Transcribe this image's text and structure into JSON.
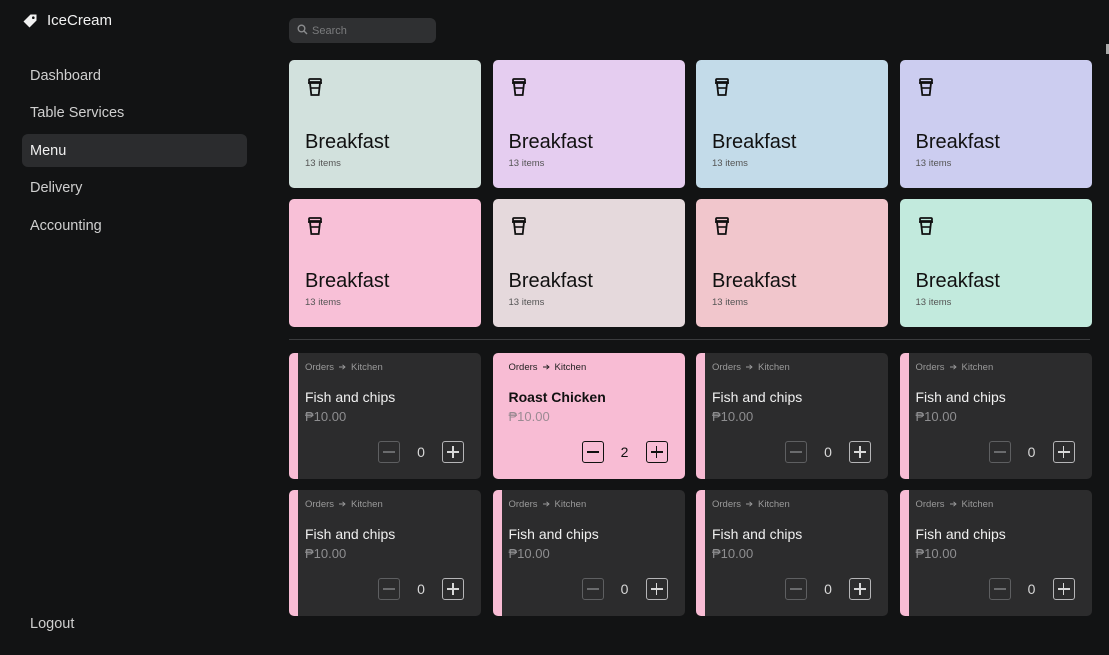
{
  "brand": {
    "name": "IceCream",
    "icon": "tag-icon"
  },
  "sidebar": {
    "items": [
      {
        "label": "Dashboard",
        "active": false
      },
      {
        "label": "Table Services",
        "active": false
      },
      {
        "label": "Menu",
        "active": true
      },
      {
        "label": "Delivery",
        "active": false
      },
      {
        "label": "Accounting",
        "active": false
      }
    ],
    "logout_label": "Logout"
  },
  "search": {
    "placeholder": "Search",
    "value": ""
  },
  "categories": [
    {
      "title": "Breakfast",
      "count": "13 items",
      "color": "#d2e1dd",
      "icon": "cup-icon"
    },
    {
      "title": "Breakfast",
      "count": "13 items",
      "color": "#e5cdf0",
      "icon": "cup-icon"
    },
    {
      "title": "Breakfast",
      "count": "13 items",
      "color": "#c3dbe9",
      "icon": "cup-icon"
    },
    {
      "title": "Breakfast",
      "count": "13 items",
      "color": "#cccdf0",
      "icon": "cup-icon"
    },
    {
      "title": "Breakfast",
      "count": "13 items",
      "color": "#f8c0d7",
      "icon": "cup-icon"
    },
    {
      "title": "Breakfast",
      "count": "13 items",
      "color": "#e5d9dc",
      "icon": "cup-icon"
    },
    {
      "title": "Breakfast",
      "count": "13 items",
      "color": "#f1c6cc",
      "icon": "cup-icon"
    },
    {
      "title": "Breakfast",
      "count": "13 items",
      "color": "#c2eadd",
      "icon": "cup-icon"
    }
  ],
  "orders": [
    {
      "from": "Orders",
      "to": "Kitchen",
      "name": "Fish and chips",
      "price": "₱10.00",
      "qty": "0",
      "active": false
    },
    {
      "from": "Orders",
      "to": "Kitchen",
      "name": "Roast Chicken",
      "price": "₱10.00",
      "qty": "2",
      "active": true
    },
    {
      "from": "Orders",
      "to": "Kitchen",
      "name": "Fish and chips",
      "price": "₱10.00",
      "qty": "0",
      "active": false
    },
    {
      "from": "Orders",
      "to": "Kitchen",
      "name": "Fish and chips",
      "price": "₱10.00",
      "qty": "0",
      "active": false
    },
    {
      "from": "Orders",
      "to": "Kitchen",
      "name": "Fish and chips",
      "price": "₱10.00",
      "qty": "0",
      "active": false
    },
    {
      "from": "Orders",
      "to": "Kitchen",
      "name": "Fish and chips",
      "price": "₱10.00",
      "qty": "0",
      "active": false
    },
    {
      "from": "Orders",
      "to": "Kitchen",
      "name": "Fish and chips",
      "price": "₱10.00",
      "qty": "0",
      "active": false
    },
    {
      "from": "Orders",
      "to": "Kitchen",
      "name": "Fish and chips",
      "price": "₱10.00",
      "qty": "0",
      "active": false
    }
  ],
  "colors": {
    "background": "#121314",
    "accent": "#f8bcd4",
    "card": "#2c2c2d"
  }
}
